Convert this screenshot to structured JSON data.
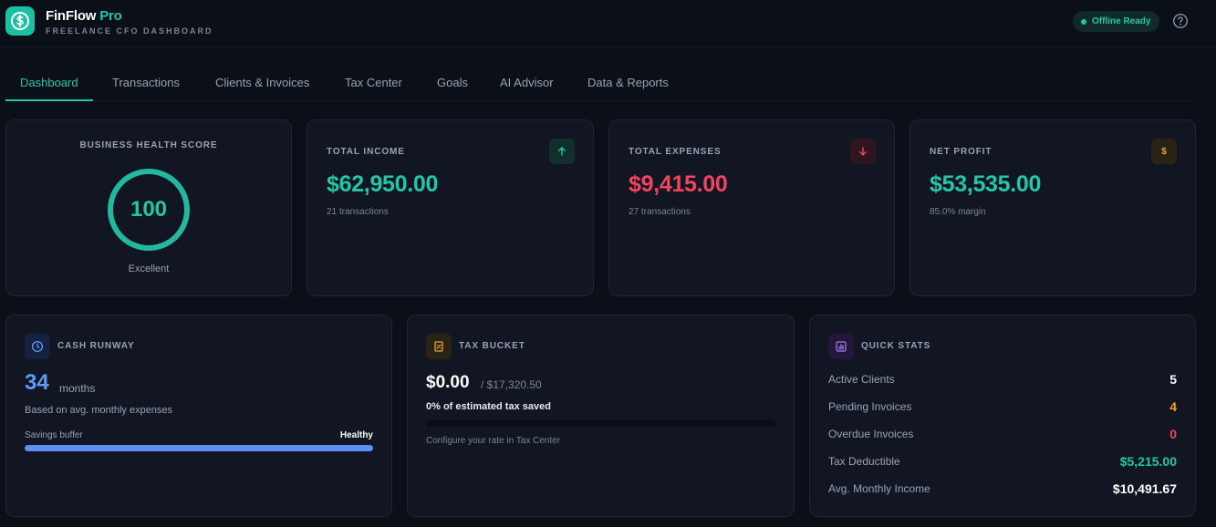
{
  "app": {
    "name": "FinFlow",
    "name_accent": "Pro",
    "subtitle": "FREELANCE CFO DASHBOARD",
    "offline_badge": "Offline Ready",
    "icons": {
      "logo": "dollar-coin-icon",
      "help": "help-circle-icon"
    }
  },
  "tabs": [
    {
      "label": "Dashboard",
      "active": true
    },
    {
      "label": "Transactions",
      "active": false
    },
    {
      "label": "Clients & Invoices",
      "active": false
    },
    {
      "label": "Tax Center",
      "active": false
    },
    {
      "label": "Goals",
      "active": false
    },
    {
      "label": "AI Advisor",
      "active": false
    },
    {
      "label": "Data & Reports",
      "active": false
    }
  ],
  "health": {
    "label": "BUSINESS HEALTH SCORE",
    "score": "100",
    "score_fraction": 1.0,
    "status": "Excellent"
  },
  "stats": [
    {
      "label": "TOTAL INCOME",
      "value": "$62,950.00",
      "sub": "21 transactions",
      "icon": "arrow-up-icon",
      "color": "#22c7a6",
      "icon_bg": "#11302c"
    },
    {
      "label": "TOTAL EXPENSES",
      "value": "$9,415.00",
      "sub": "27 transactions",
      "icon": "arrow-down-icon",
      "color": "#f2435f",
      "icon_bg": "#2d1620"
    },
    {
      "label": "NET PROFIT",
      "value": "$53,535.00",
      "sub": "85.0% margin",
      "icon": "dollar-icon",
      "color": "#22c7a6",
      "icon_bg": "#2b2216",
      "icon_color": "#e9a23b"
    }
  ],
  "cash_runway": {
    "label": "CASH RUNWAY",
    "value": "34",
    "unit": "months",
    "description": "Based on avg. monthly expenses",
    "buffer_label": "Savings buffer",
    "buffer_status": "Healthy",
    "buffer_fraction": 1.0,
    "icon": "clock-icon"
  },
  "tax_bucket": {
    "label": "TAX BUCKET",
    "saved": "$0.00",
    "target": "/ $17,320.50",
    "saved_text": "0% of estimated tax saved",
    "saved_fraction": 0.0,
    "note": "Configure your rate in Tax Center",
    "icon": "receipt-icon"
  },
  "quick_stats": {
    "label": "QUICK STATS",
    "icon": "bar-chart-icon",
    "rows": [
      {
        "name": "Active Clients",
        "value": "5",
        "color": "#ffffff"
      },
      {
        "name": "Pending Invoices",
        "value": "4",
        "color": "#f59e2a"
      },
      {
        "name": "Overdue Invoices",
        "value": "0",
        "color": "#f2435f"
      },
      {
        "name": "Tax Deductible",
        "value": "$5,215.00",
        "color": "#22c7a6"
      },
      {
        "name": "Avg. Monthly Income",
        "value": "$10,491.67",
        "color": "#ffffff"
      }
    ]
  },
  "colors": {
    "accent": "#22c7a6",
    "danger": "#f2435f",
    "warning": "#e9a23b",
    "info": "#5b9cf6",
    "card": "#111622",
    "background": "#0b0f18"
  }
}
